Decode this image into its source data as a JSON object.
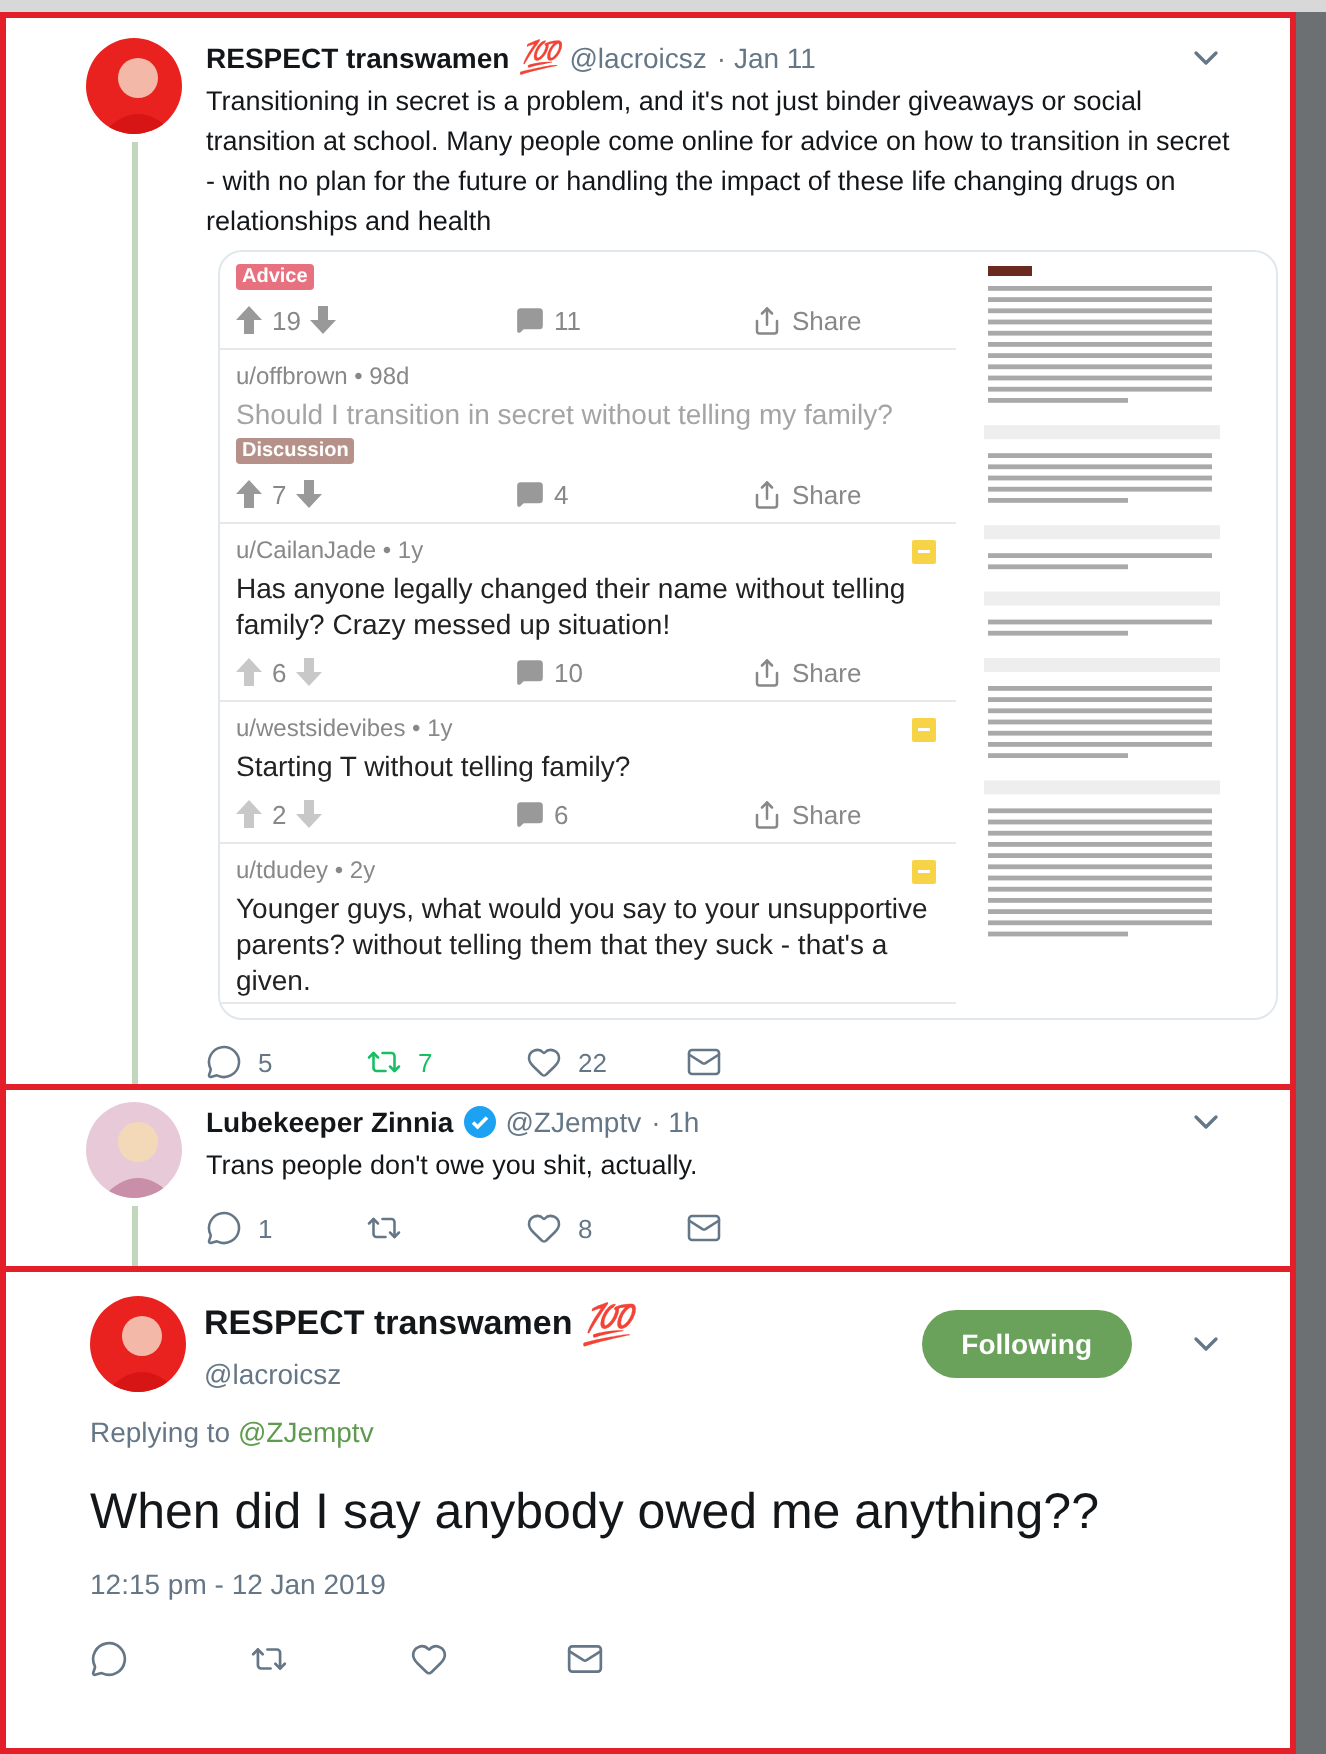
{
  "tweets": [
    {
      "kind": "thread",
      "name": "RESPECT transwamen",
      "emoji": "💯",
      "handle": "@lacroicsz",
      "time": "· Jan 11",
      "text": "Transitioning in secret is a problem, and it's not just binder giveaways or social transition at school. Many people come online for advice on how to transition in secret - with no plan for the future or handling the impact of these life changing drugs on relationships and health",
      "attachment": {
        "posts": [
          {
            "tag": {
              "label": "Advice",
              "color": "#e8717f"
            },
            "archived": false,
            "votes": "19",
            "comments": "11",
            "share": "Share"
          },
          {
            "meta": "u/offbrown • 98d",
            "title": "Should I transition in secret without telling my family?",
            "title_muted": true,
            "tag": {
              "label": "Discussion",
              "color": "#b5918a"
            },
            "archived": false,
            "votes": "7",
            "comments": "4",
            "share": "Share"
          },
          {
            "meta": "u/CailanJade • 1y",
            "title": "Has anyone legally changed their name without telling family? Crazy messed up situation!",
            "title_muted": false,
            "archived": true,
            "votes": "6",
            "comments": "10",
            "share": "Share"
          },
          {
            "meta": "u/westsidevibes • 1y",
            "title": "Starting T without telling family?",
            "title_muted": false,
            "archived": true,
            "votes": "2",
            "comments": "6",
            "share": "Share"
          },
          {
            "meta": "u/tdudey • 2y",
            "title": "Younger guys, what would you say to your unsupportive parents? without telling them that they suck - that's a given.",
            "title_muted": false,
            "archived": true
          }
        ]
      },
      "actions": [
        {
          "kind": "reply",
          "count": "5",
          "active": false
        },
        {
          "kind": "retweet",
          "count": "7",
          "active": true
        },
        {
          "kind": "like",
          "count": "22",
          "active": false
        },
        {
          "kind": "message"
        }
      ]
    },
    {
      "kind": "thread",
      "name": "Lubekeeper Zinnia",
      "verified": true,
      "handle": "@ZJemptv",
      "time": "· 1h",
      "text": "Trans people don't owe you shit, actually.",
      "highlighted": true,
      "actions": [
        {
          "kind": "reply",
          "count": "1",
          "active": false
        },
        {
          "kind": "retweet",
          "active": false
        },
        {
          "kind": "like",
          "count": "8",
          "active": false
        },
        {
          "kind": "message"
        }
      ]
    },
    {
      "kind": "focus",
      "name": "RESPECT transwamen",
      "emoji": "💯",
      "handle": "@lacroicsz",
      "follow": "Following",
      "replying_label": "Replying to",
      "replying_to": "@ZJemptv",
      "text": "When did I say anybody owed me anything??",
      "timestamp": "12:15 pm - 12 Jan 2019",
      "actions": [
        {
          "kind": "reply",
          "active": false
        },
        {
          "kind": "retweet",
          "active": false
        },
        {
          "kind": "like",
          "active": false
        },
        {
          "kind": "message"
        }
      ]
    }
  ]
}
